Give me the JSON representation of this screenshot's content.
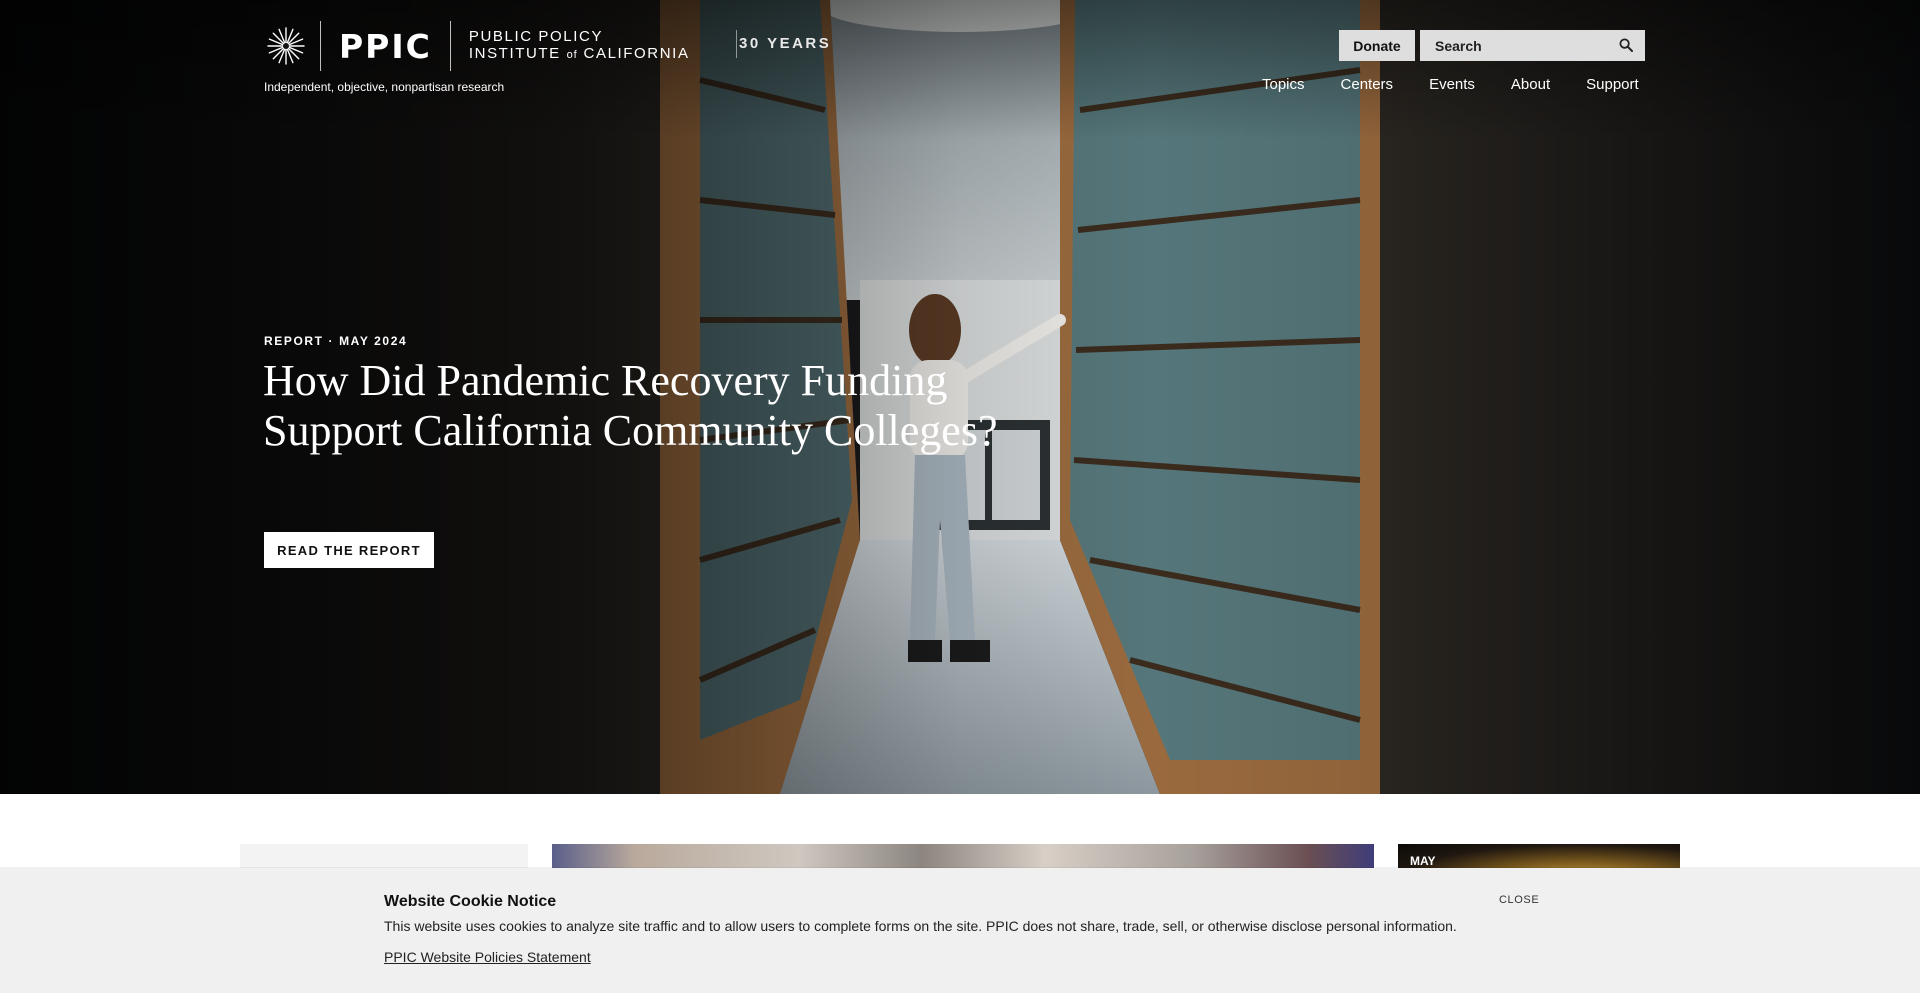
{
  "header": {
    "logo": {
      "wordmark": "PPIC",
      "name_line1": "PUBLIC POLICY",
      "name_line2_a": "INSTITUTE",
      "name_line2_of": "of",
      "name_line2_b": "CALIFORNIA"
    },
    "tagline": "Independent, objective, nonpartisan research",
    "anniversary_badge": "30 YEARS",
    "donate_label": "Donate",
    "search": {
      "placeholder": "Search",
      "value": ""
    },
    "nav": [
      "Topics",
      "Centers",
      "Events",
      "About",
      "Support"
    ]
  },
  "hero": {
    "eyebrow": "REPORT · MAY 2024",
    "headline": "How Did Pandemic Recovery Funding Support California Community Colleges?",
    "cta_label": "READ THE REPORT"
  },
  "cards": {
    "right_label": "MAY"
  },
  "cookie_notice": {
    "title": "Website Cookie Notice",
    "text": "This website uses cookies to analyze site traffic and to allow users to complete forms on the site. PPIC does not share, trade, sell, or otherwise disclose personal information.",
    "link_label": "PPIC Website Policies Statement",
    "close_label": "CLOSE"
  },
  "colors": {
    "cookie_bg": "#f0f0f0",
    "header_button_bg": "#dedede",
    "text_on_hero": "#ffffff"
  }
}
